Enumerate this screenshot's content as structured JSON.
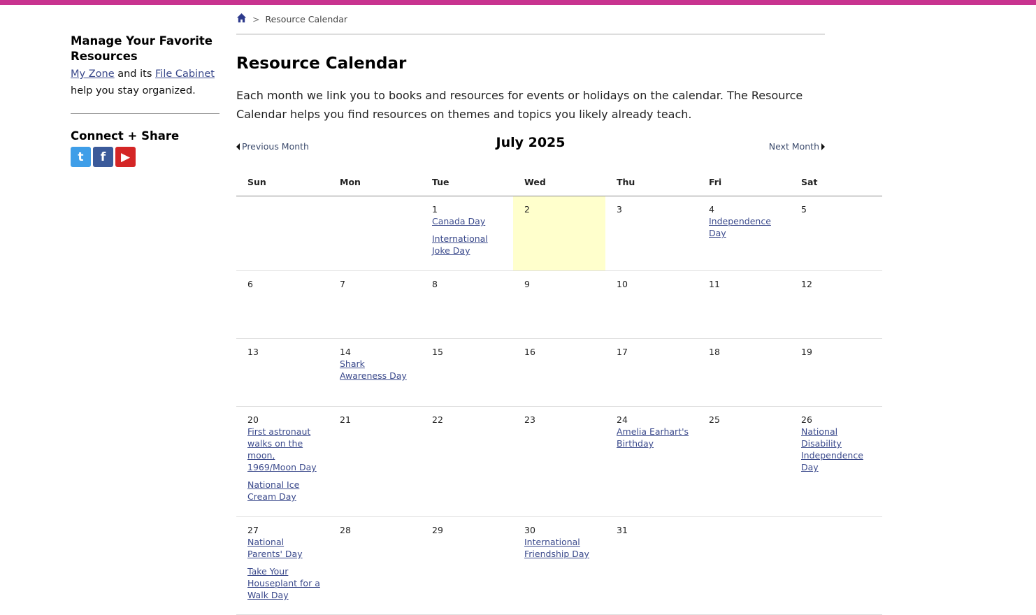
{
  "colors": {
    "topbar": "#c8338f",
    "link": "#3b4a8c",
    "today": "#ffffcc"
  },
  "sidebar": {
    "manage_heading": "Manage Your Favorite Resources",
    "my_zone_link": "My Zone",
    "and_its": "and its",
    "file_cabinet_link": "File Cabinet",
    "help_text": "help you stay organized.",
    "connect_heading": "Connect + Share",
    "social": [
      {
        "icon": "twitter-icon",
        "glyph": "t"
      },
      {
        "icon": "facebook-icon",
        "glyph": "f"
      },
      {
        "icon": "youtube-icon",
        "glyph": "▶"
      }
    ]
  },
  "breadcrumb": {
    "separator": ">",
    "current": "Resource Calendar"
  },
  "page": {
    "title": "Resource Calendar",
    "intro": "Each month we link you to books and resources for events or holidays on the calendar. The Resource Calendar helps you find resources on themes and topics you likely already teach."
  },
  "calendar": {
    "month_title": "July 2025",
    "prev_label": "Previous Month",
    "next_label": "Next Month",
    "weekdays": [
      "Sun",
      "Mon",
      "Tue",
      "Wed",
      "Thu",
      "Fri",
      "Sat"
    ],
    "weeks": [
      {
        "days": [
          {
            "num": "",
            "events": []
          },
          {
            "num": "",
            "events": []
          },
          {
            "num": "1",
            "events": [
              "Canada Day",
              "International Joke Day"
            ]
          },
          {
            "num": "2",
            "events": [],
            "today": true
          },
          {
            "num": "3",
            "events": []
          },
          {
            "num": "4",
            "events": [
              "Independence Day"
            ]
          },
          {
            "num": "5",
            "events": []
          }
        ]
      },
      {
        "days": [
          {
            "num": "6",
            "events": []
          },
          {
            "num": "7",
            "events": []
          },
          {
            "num": "8",
            "events": []
          },
          {
            "num": "9",
            "events": []
          },
          {
            "num": "10",
            "events": []
          },
          {
            "num": "11",
            "events": []
          },
          {
            "num": "12",
            "events": []
          }
        ]
      },
      {
        "days": [
          {
            "num": "13",
            "events": []
          },
          {
            "num": "14",
            "events": [
              "Shark Awareness Day"
            ]
          },
          {
            "num": "15",
            "events": []
          },
          {
            "num": "16",
            "events": []
          },
          {
            "num": "17",
            "events": []
          },
          {
            "num": "18",
            "events": []
          },
          {
            "num": "19",
            "events": []
          }
        ]
      },
      {
        "days": [
          {
            "num": "20",
            "events": [
              "First astronaut walks on the moon, 1969/Moon Day",
              "National Ice Cream Day"
            ]
          },
          {
            "num": "21",
            "events": []
          },
          {
            "num": "22",
            "events": []
          },
          {
            "num": "23",
            "events": []
          },
          {
            "num": "24",
            "events": [
              "Amelia Earhart's Birthday"
            ]
          },
          {
            "num": "25",
            "events": []
          },
          {
            "num": "26",
            "events": [
              "National Disability Independence Day"
            ]
          }
        ]
      },
      {
        "days": [
          {
            "num": "27",
            "events": [
              "National Parents' Day",
              "Take Your Houseplant for a Walk Day"
            ]
          },
          {
            "num": "28",
            "events": []
          },
          {
            "num": "29",
            "events": []
          },
          {
            "num": "30",
            "events": [
              "International Friendship Day"
            ]
          },
          {
            "num": "31",
            "events": []
          },
          {
            "num": "",
            "events": []
          },
          {
            "num": "",
            "events": []
          }
        ]
      }
    ]
  }
}
